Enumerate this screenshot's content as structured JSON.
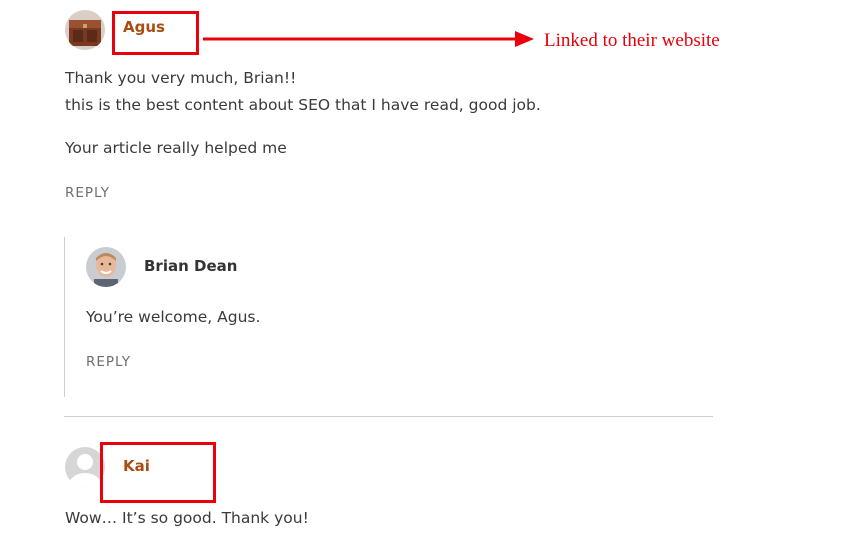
{
  "comments": [
    {
      "author": "Agus",
      "lines": [
        "Thank you very much, Brian!!",
        "this is the best content about SEO that I have read, good job.",
        "Your article really helped me"
      ],
      "reply_label": "REPLY"
    },
    {
      "author": "Brian Dean",
      "lines": [
        "You’re welcome, Agus."
      ],
      "reply_label": "REPLY"
    },
    {
      "author": "Kai",
      "lines": [
        "Wow… It’s so good. Thank you!"
      ]
    }
  ],
  "annotation": {
    "text": "Linked to their website",
    "color": "#e8000b"
  },
  "colors": {
    "author_link": "#a84e14",
    "text": "#3a3a3a",
    "reply": "#6f6f6f",
    "divider": "#cfcfcf"
  },
  "icons": {
    "agus_avatar": "wooden-chest-photo-avatar",
    "brian_avatar": "man-portrait-avatar",
    "kai_avatar": "default-person-avatar",
    "annotation_arrow": "arrow-right-icon"
  }
}
